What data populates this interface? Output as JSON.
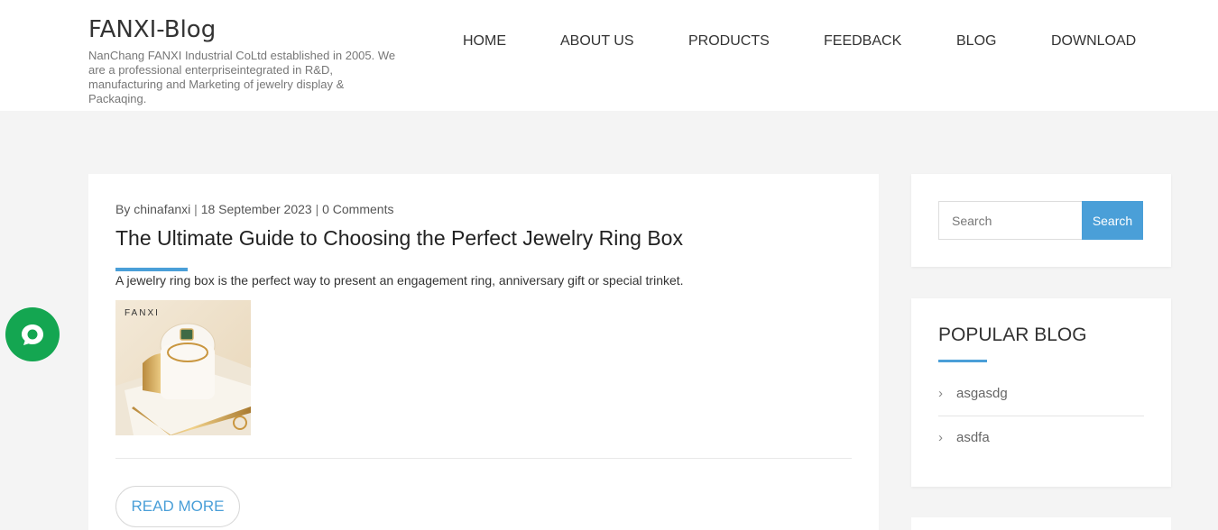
{
  "header": {
    "site_title": "FANXI-Blog",
    "site_description": "NanChang FANXI Industrial CoLtd established in 2005. We are a professional enterpriseintegrated in R&D, manufacturing and Marketing of jewelry display & Packaqing."
  },
  "nav": {
    "items": [
      {
        "label": "HOME"
      },
      {
        "label": "ABOUT US"
      },
      {
        "label": "PRODUCTS"
      },
      {
        "label": "FEEDBACK"
      },
      {
        "label": "BLOG"
      },
      {
        "label": "DOWNLOAD"
      }
    ]
  },
  "post": {
    "author": "By chinafanxi",
    "date": "18 September 2023",
    "comments": "0 Comments",
    "separator": "|",
    "title": "The Ultimate Guide to Choosing the Perfect Jewelry Ring Box",
    "excerpt": "A jewelry ring box is the perfect way to present an engagement ring, anniversary gift or special trinket.",
    "image_brand": "FANXI",
    "read_more_label": "READ MORE"
  },
  "sidebar": {
    "search": {
      "placeholder": "Search",
      "button_label": "Search"
    },
    "popular": {
      "title": "POPULAR BLOG",
      "items": [
        {
          "label": "asgasdg"
        },
        {
          "label": "asdfa"
        }
      ]
    }
  },
  "icons": {
    "chevron": "chevron-right-icon",
    "chat": "chat-bubble-icon"
  },
  "colors": {
    "accent": "#4a9fd8",
    "chat": "#14a651",
    "page_bg": "#f4f4f4"
  }
}
